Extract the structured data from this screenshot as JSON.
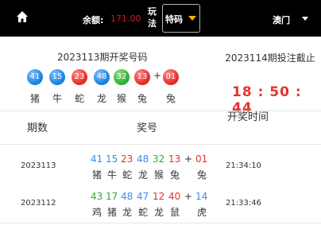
{
  "topbar": {
    "balance_label": "余额:",
    "balance_value": "171.00",
    "play_label": "玩法",
    "type_value": "特码",
    "region_value": "澳门",
    "home_icon": "home-icon"
  },
  "current": {
    "title": "2023113期开奖号码",
    "balls": [
      {
        "n": "41",
        "c": "blue",
        "z": "猪"
      },
      {
        "n": "15",
        "c": "blue",
        "z": "牛"
      },
      {
        "n": "23",
        "c": "red",
        "z": "蛇"
      },
      {
        "n": "48",
        "c": "blue",
        "z": "龙"
      },
      {
        "n": "32",
        "c": "green",
        "z": "猴"
      },
      {
        "n": "13",
        "c": "red",
        "z": "兔"
      }
    ],
    "special": {
      "n": "01",
      "c": "red",
      "z": "兔"
    },
    "plus": "+"
  },
  "next": {
    "title": "2023114期投注截止",
    "countdown": "18 : 50 : 44"
  },
  "table": {
    "headers": [
      "期数",
      "奖号",
      "开奖时间"
    ],
    "rows": [
      {
        "issue": "2023113",
        "nums": [
          {
            "n": "41",
            "c": "blue",
            "z": "猪"
          },
          {
            "n": "15",
            "c": "blue",
            "z": "牛"
          },
          {
            "n": "23",
            "c": "red",
            "z": "蛇"
          },
          {
            "n": "48",
            "c": "blue",
            "z": "龙"
          },
          {
            "n": "32",
            "c": "green",
            "z": "猴"
          },
          {
            "n": "13",
            "c": "red",
            "z": "兔"
          }
        ],
        "special": {
          "n": "01",
          "c": "red",
          "z": "兔"
        },
        "time": "21:34:10"
      },
      {
        "issue": "2023112",
        "nums": [
          {
            "n": "43",
            "c": "green",
            "z": "鸡"
          },
          {
            "n": "17",
            "c": "green",
            "z": "猪"
          },
          {
            "n": "48",
            "c": "blue",
            "z": "龙"
          },
          {
            "n": "47",
            "c": "blue",
            "z": "蛇"
          },
          {
            "n": "12",
            "c": "red",
            "z": "龙"
          },
          {
            "n": "40",
            "c": "red",
            "z": "鼠"
          }
        ],
        "special": {
          "n": "14",
          "c": "blue",
          "z": "虎"
        },
        "time": "21:33:46"
      }
    ]
  }
}
